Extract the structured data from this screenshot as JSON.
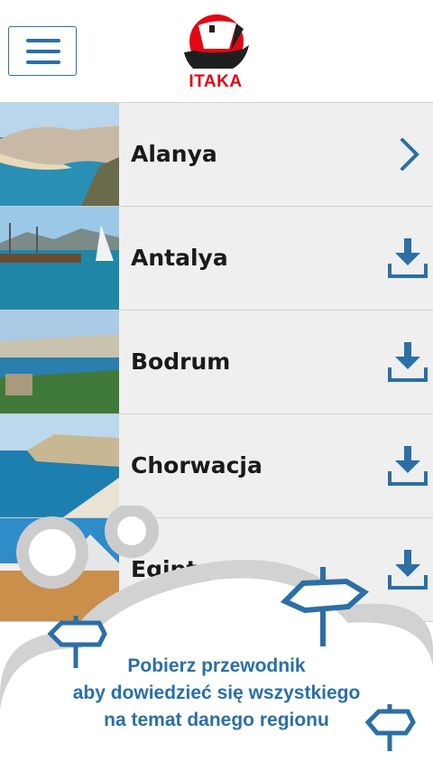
{
  "header": {
    "menu_icon": "hamburger-menu-icon",
    "logo_text": "ITAKA",
    "brand_color": "#e30613",
    "accent_color": "#2b6fa6"
  },
  "destinations": [
    {
      "label": "Alanya",
      "action_icon": "chevron-right-icon"
    },
    {
      "label": "Antalya",
      "action_icon": "download-icon"
    },
    {
      "label": "Bodrum",
      "action_icon": "download-icon"
    },
    {
      "label": "Chorwacja",
      "action_icon": "download-icon"
    },
    {
      "label": "Egipt",
      "action_icon": "download-icon"
    }
  ],
  "promo": {
    "line1": "Pobierz przewodnik",
    "line2": "aby dowiedzieć się wszystkiego",
    "line3": "na temat danego regionu",
    "icon": "signpost-icon"
  }
}
